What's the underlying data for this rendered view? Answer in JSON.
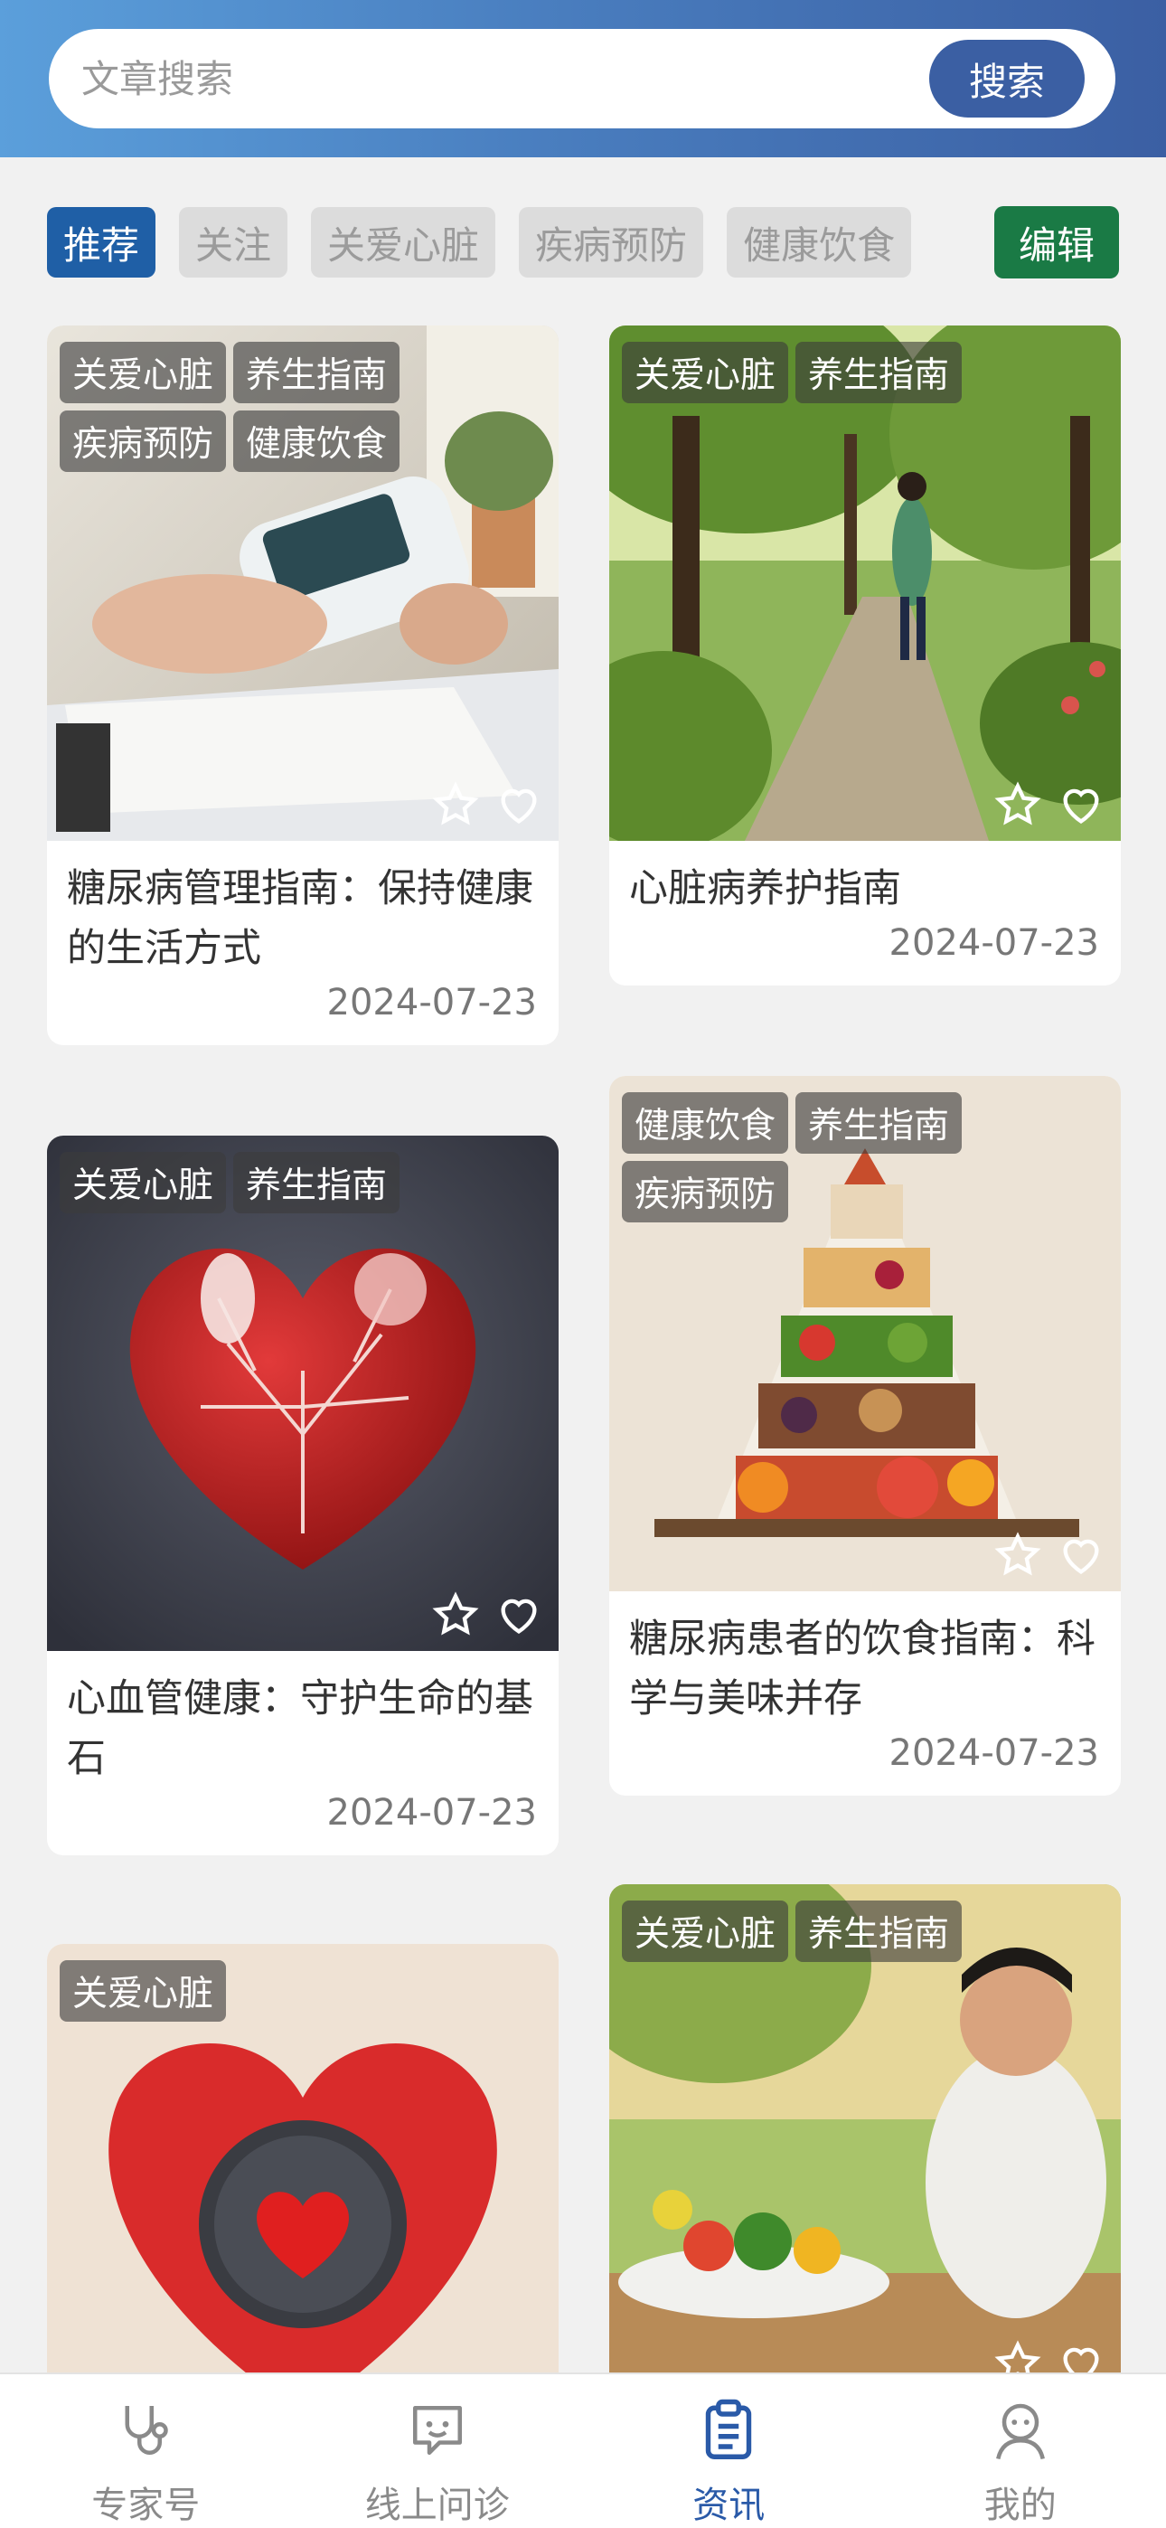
{
  "search": {
    "placeholder": "文章搜索",
    "button_label": "搜索"
  },
  "categories": [
    {
      "label": "推荐",
      "active": true
    },
    {
      "label": "关注",
      "active": false
    },
    {
      "label": "关爱心脏",
      "active": false
    },
    {
      "label": "疾病预防",
      "active": false
    },
    {
      "label": "健康饮食",
      "active": false
    }
  ],
  "edit_label": "编辑",
  "articles": [
    {
      "title": "糖尿病管理指南：保持健康的生活方式",
      "date": "2024-07-23",
      "tags": [
        "关爱心脏",
        "养生指南",
        "疾病预防",
        "健康饮食"
      ],
      "image": "blood-glucose-meter-photo"
    },
    {
      "title": "心脏病养护指南",
      "date": "2024-07-23",
      "tags": [
        "关爱心脏",
        "养生指南"
      ],
      "image": "park-walking-photo"
    },
    {
      "title": "心血管健康：守护生命的基石",
      "date": "2024-07-23",
      "tags": [
        "关爱心脏",
        "养生指南"
      ],
      "image": "veined-heart-photo"
    },
    {
      "title": "糖尿病患者的饮食指南：科学与美味并存",
      "date": "2024-07-23",
      "tags": [
        "健康饮食",
        "养生指南",
        "疾病预防"
      ],
      "image": "food-pyramid-photo"
    },
    {
      "title": "",
      "date": "",
      "tags": [
        "关爱心脏"
      ],
      "image": "heart-clock-photo"
    },
    {
      "title": "",
      "date": "",
      "tags": [
        "关爱心脏",
        "养生指南"
      ],
      "image": "man-salad-photo"
    }
  ],
  "tabbar": [
    {
      "label": "专家号",
      "icon": "stethoscope-icon",
      "active": false
    },
    {
      "label": "线上问诊",
      "icon": "chat-bubble-icon",
      "active": false
    },
    {
      "label": "资讯",
      "icon": "clipboard-icon",
      "active": true
    },
    {
      "label": "我的",
      "icon": "user-icon",
      "active": false
    }
  ]
}
